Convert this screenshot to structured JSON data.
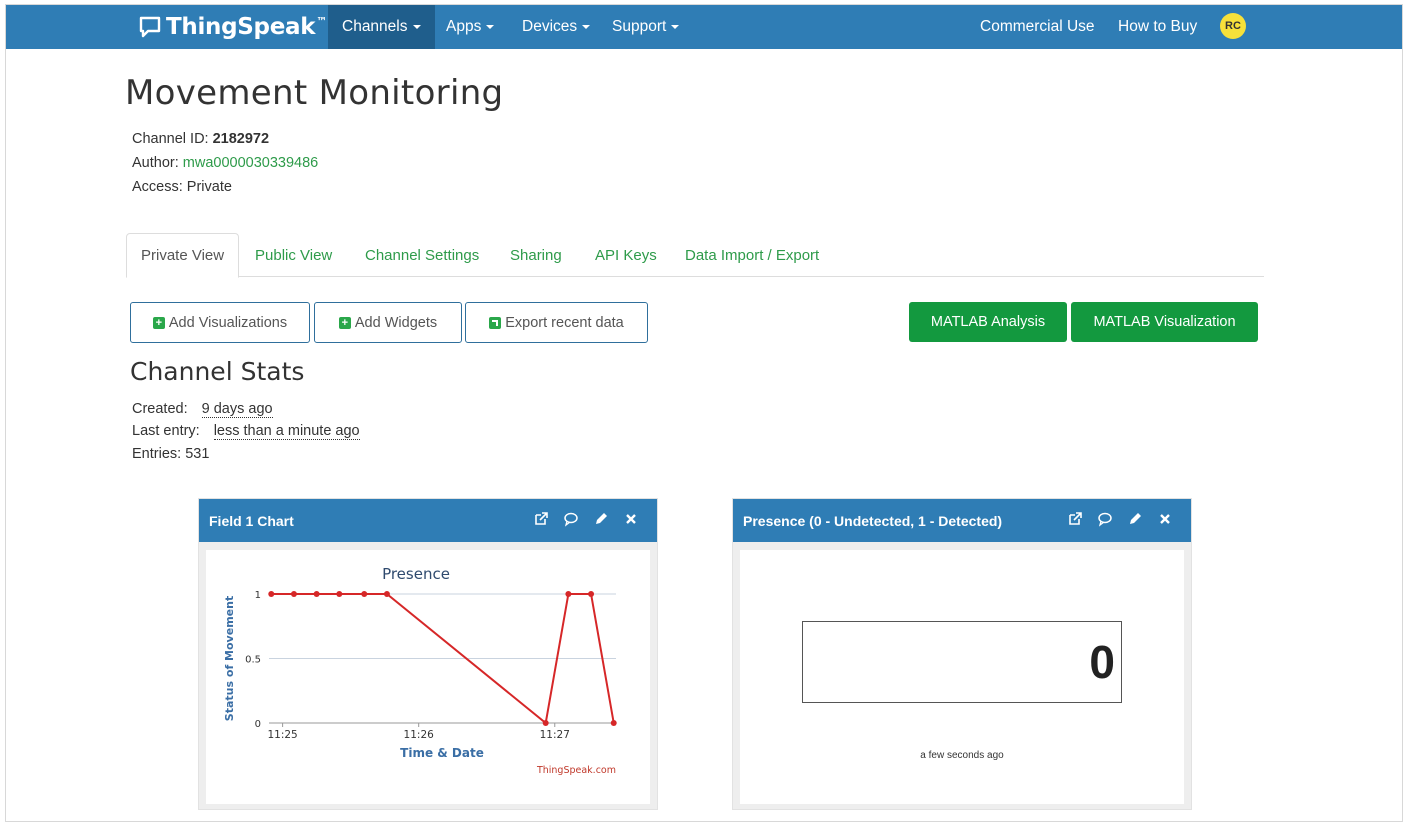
{
  "nav": {
    "brand": "ThingSpeak",
    "trademark": "™",
    "items": [
      {
        "label": "Channels",
        "caret": true,
        "active": true
      },
      {
        "label": "Apps",
        "caret": true
      },
      {
        "label": "Devices",
        "caret": true
      },
      {
        "label": "Support",
        "caret": true
      }
    ],
    "right": [
      {
        "label": "Commercial Use"
      },
      {
        "label": "How to Buy"
      }
    ],
    "avatar": "RC"
  },
  "channel": {
    "title": "Movement Monitoring",
    "id_label": "Channel ID:",
    "id_value": "2182972",
    "author_label": "Author:",
    "author_value": "mwa0000030339486",
    "access_label": "Access:",
    "access_value": "Private"
  },
  "tabs": [
    "Private View",
    "Public View",
    "Channel Settings",
    "Sharing",
    "API Keys",
    "Data Import / Export"
  ],
  "actions": {
    "add_visualizations": "Add Visualizations",
    "add_widgets": "Add Widgets",
    "export_recent": "Export recent data",
    "matlab_analysis": "MATLAB Analysis",
    "matlab_visualization": "MATLAB Visualization"
  },
  "stats": {
    "title": "Channel Stats",
    "created_label": "Created:",
    "created_value": "9 days ago",
    "last_entry_label": "Last entry:",
    "last_entry_value": "less than a minute ago",
    "entries_label": "Entries:",
    "entries_value": "531"
  },
  "widgets": {
    "chart_title": "Field 1 Chart",
    "status_title": "Presence (0 - Undetected, 1 - Detected)",
    "status_value": "0",
    "status_time": "a few seconds ago"
  },
  "colors": {
    "navbar": "#2f7db5",
    "navbar_active": "#1f5e8c",
    "link_green": "#2e9b4a",
    "button_green": "#13993f",
    "chart_line": "#d62728"
  },
  "chart_data": {
    "type": "line",
    "title": "Presence",
    "xlabel": "Time & Date",
    "ylabel": "Status of Movement",
    "credit": "ThingSpeak.com",
    "x_ticks": [
      "11:25",
      "11:26",
      "11:27"
    ],
    "y_ticks": [
      "0",
      "0.5",
      "1"
    ],
    "ylim": [
      0,
      1
    ],
    "grid": true,
    "legend": "none",
    "series": [
      {
        "x": [
          "11:24:55",
          "11:25:05",
          "11:25:15",
          "11:25:25",
          "11:25:36",
          "11:25:46",
          "11:26:56",
          "11:27:06",
          "11:27:16",
          "11:27:26"
        ],
        "values": [
          1,
          1,
          1,
          1,
          1,
          1,
          0,
          1,
          1,
          0
        ]
      }
    ]
  }
}
